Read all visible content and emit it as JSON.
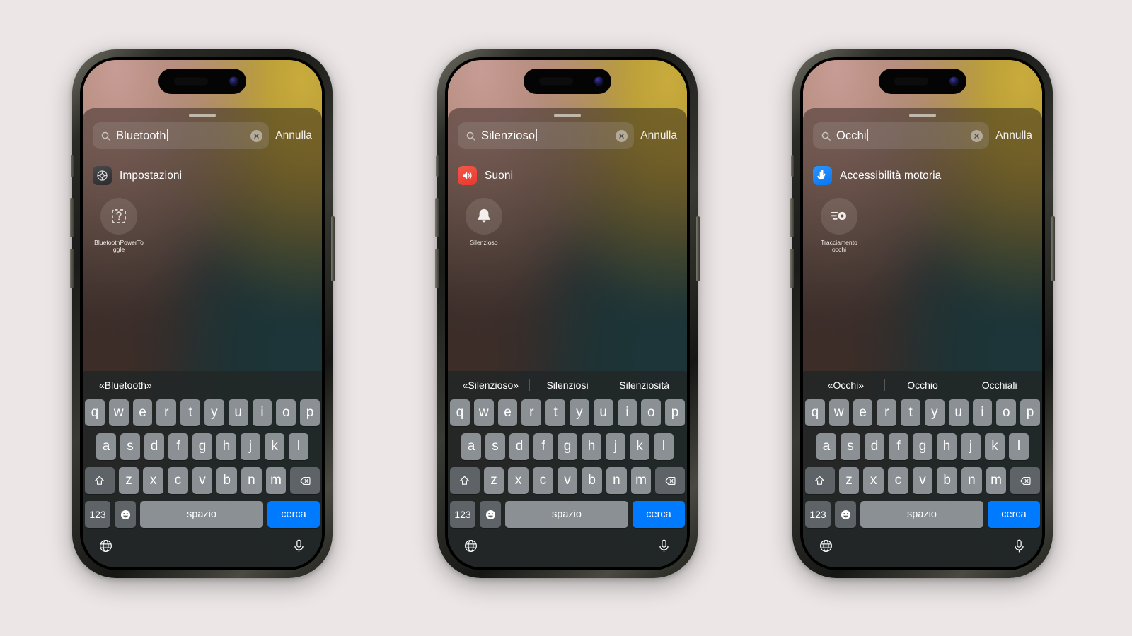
{
  "page": {
    "background_color": "#ece6e6",
    "device_count": 3,
    "accent_color": "#007aff"
  },
  "keyboard_common": {
    "row1": [
      "q",
      "w",
      "e",
      "r",
      "t",
      "y",
      "u",
      "i",
      "o",
      "p"
    ],
    "row2": [
      "a",
      "s",
      "d",
      "f",
      "g",
      "h",
      "j",
      "k",
      "l"
    ],
    "row3": [
      "z",
      "x",
      "c",
      "v",
      "b",
      "n",
      "m"
    ],
    "shift_icon": "shift-icon",
    "backspace_icon": "backspace-icon",
    "numbers_label": "123",
    "emoji_icon": "emoji-icon",
    "space_label": "spazio",
    "go_label": "cerca",
    "globe_icon": "globe-icon",
    "mic_icon": "microphone-icon"
  },
  "phones": [
    {
      "id": "phone-1",
      "search": {
        "value": "Bluetooth",
        "search_icon": "search-icon",
        "clear_icon": "clear-circle-icon",
        "cancel_label": "Annulla"
      },
      "results": {
        "app": {
          "label": "Impostazioni",
          "icon": "settings-gear-icon",
          "icon_style": "settings"
        },
        "shortcut": {
          "label": "BluetoothPowerToggle",
          "icon": "unknown-placeholder-icon"
        }
      },
      "suggestions": [
        "«Bluetooth»",
        "",
        ""
      ]
    },
    {
      "id": "phone-2",
      "search": {
        "value": "Silenzioso",
        "search_icon": "search-icon",
        "clear_icon": "clear-circle-icon",
        "cancel_label": "Annulla"
      },
      "results": {
        "app": {
          "label": "Suoni",
          "icon": "speaker-wave-icon",
          "icon_style": "sounds"
        },
        "shortcut": {
          "label": "Silenzioso",
          "icon": "bell-icon"
        }
      },
      "suggestions": [
        "«Silenzioso»",
        "Silenziosi",
        "Silenziosità"
      ]
    },
    {
      "id": "phone-3",
      "search": {
        "value": "Occhi",
        "search_icon": "search-icon",
        "clear_icon": "clear-circle-icon",
        "cancel_label": "Annulla"
      },
      "results": {
        "app": {
          "label": "Accessibilità motoria",
          "icon": "pointer-hand-icon",
          "icon_style": "access"
        },
        "shortcut": {
          "label": "Tracciamento occhi",
          "icon": "eye-tracking-icon"
        }
      },
      "suggestions": [
        "«Occhi»",
        "Occhio",
        "Occhiali"
      ]
    }
  ]
}
